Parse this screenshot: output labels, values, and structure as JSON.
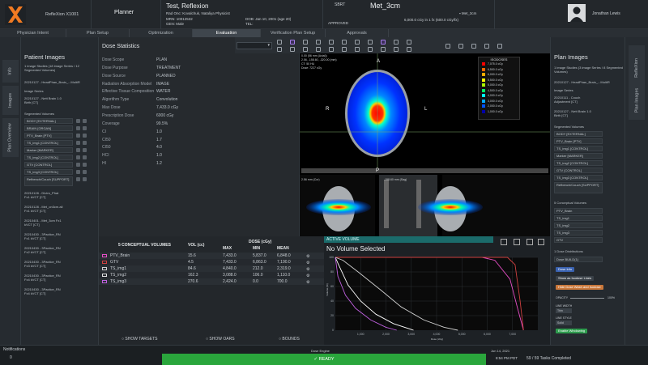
{
  "header": {
    "company": "RefleXion X1001",
    "role": "Planner",
    "patient_name": "Test, Reflexion",
    "rad_onc": "Rad Onc: Kovalchuk, Nataliya Physicist",
    "mrn": "MRN: 10012532",
    "gen": "GEN: Male",
    "dob": "DOB: Jan 10, 2001 (age 20)",
    "tel": "TEL:",
    "sbrt": "SBRT",
    "plan_name": "Met_3cm",
    "approved": "APPROVED",
    "plan_sub": "Met_3cm",
    "dose_rx": "6,000.0 cGy in 1 fx (600.0 cGy/fx)",
    "user_name": "Jonathan Lewis"
  },
  "tabs": [
    "Physician Intent",
    "Plan Setup",
    "Optimization",
    "Evaluation",
    "Verification Plan Setup",
    "Approvals"
  ],
  "active_tab": "Evaluation",
  "left_rail": {
    "tabs": [
      "Info",
      "Images",
      "Plan Overview"
    ]
  },
  "patient_images": {
    "title": "Patient Images",
    "summary": "1 image Studies (18 image Series / 12 Segmented Volumes)",
    "study": "20210127 - HeadPhan_Brain_...MultiR",
    "image_series_label": "Image Series",
    "series_1": "20210127 - Nett Brain 1.0 Birth [CT]",
    "segmented_label": "Segmented Volumes",
    "segments": [
      "BODY [EXTERNAL]",
      "BRAIN [ORGAN]",
      "PTV_Brain [PTV]",
      "TS_img1 [CONTROL]",
      "Marker [MARKER]",
      "TS_img2 [CONTROL]",
      "GTV [CONTROL]",
      "TS_img3 [CONTROL]",
      "Refbench/Couch [SUPPORT]"
    ],
    "more_series": [
      "20210128 - DIctm_Phat Fx1 kVCT [CT]",
      "20210128 - Met_on3cm.all Fx1 kVCT [CT]",
      "20210401 - Met_3cm Fx1 kVCT [CT]",
      "20210430 - 3Pactice_RN Fx1 kVCT [CT]",
      "20210430 - 3Pactice_RN Fx2 kVCT [CT]",
      "20210430 - 3Pactice_RN Fx3 kVCT [CT]",
      "20210430 - 3Pactice_RN Fx4 kVCT [CT]",
      "20210430 - 3Pactice_RN Fx4 kVCT [CT]"
    ]
  },
  "dose_stats": {
    "title": "Dose Statistics",
    "rows": [
      {
        "label": "Dose Scope",
        "value": "PLAN"
      },
      {
        "label": "Dose Purpose",
        "value": "TREATMENT"
      },
      {
        "label": "Dose Source",
        "value": "PLANNED"
      },
      {
        "label": "Radiation Absorption Model",
        "value": "IMAGE"
      },
      {
        "label": "Effective Tissue Composition",
        "value": "WATER"
      },
      {
        "label": "Algorithm Type",
        "value": "Convolution"
      },
      {
        "label": "Max Dose",
        "value": "7,433.0 cGy"
      },
      {
        "label": "Prescription Dose",
        "value": "6000 cGy"
      },
      {
        "label": "Coverage",
        "value": "99.5%"
      },
      {
        "label": "CI",
        "value": "1.0"
      },
      {
        "label": "CI50",
        "value": "1.7"
      },
      {
        "label": "CI50",
        "value": "4.0"
      },
      {
        "label": "HCI",
        "value": "1.0"
      },
      {
        "label": "HI",
        "value": "1.2"
      }
    ]
  },
  "viewer": {
    "isodoses_label": "ISODOSES",
    "axial_info": [
      "0.00 (56 mm (Axial))",
      "2.56, -158.60, -320.00 (mm)",
      "CT: 50 HU",
      "Dose: 7227 cGy"
    ],
    "label_a": "A",
    "label_r": "R",
    "label_l": "L",
    "label_p": "P",
    "coronal_info": "2.56 mm (Cor)",
    "sagittal_info": "-158.60 mm (Sag)",
    "isodoses": [
      "7,075.0 cGy",
      "6,500.0 cGy",
      "6,000.0 cGy",
      "5,500.0 cGy",
      "5,000.0 cGy",
      "4,500.0 cGy",
      "4,000.0 cGy",
      "3,000.0 cGy",
      "2,000.0 cGy",
      "1,000.0 cGy"
    ],
    "isodose_colors": [
      "#ff0000",
      "#ff6600",
      "#ffaa00",
      "#ffff00",
      "#aaff00",
      "#00ff66",
      "#00ffff",
      "#00aaff",
      "#0055ff",
      "#0000aa"
    ]
  },
  "volumes_table": {
    "title": "5 CONCEPTUAL VOLUMES",
    "col_vol": "VOL (cc)",
    "col_dose": "DOSE (cGy)",
    "col_max": "MAX",
    "col_min": "MIN",
    "col_mean": "MEAN",
    "rows": [
      {
        "name": "PTV_Brain",
        "vol": "15.6",
        "max": "7,433.0",
        "min": "5,837.0",
        "mean": "6,848.0",
        "color": "#e84fc8"
      },
      {
        "name": "GTV",
        "vol": "4.5",
        "max": "7,433.0",
        "min": "6,863.0",
        "mean": "7,190.0",
        "color": "#d04040"
      },
      {
        "name": "TS_img1",
        "vol": "84.6",
        "max": "4,840.0",
        "min": "212.0",
        "mean": "2,319.0",
        "color": "#d0d0d0"
      },
      {
        "name": "TS_img2",
        "vol": "162.3",
        "max": "3,088.0",
        "min": "106.0",
        "mean": "1,110.0",
        "color": "#e0e0e0"
      },
      {
        "name": "TS_img3",
        "vol": "270.6",
        "max": "2,424.0",
        "min": "0.0",
        "mean": "700.0",
        "color": "#c060e0"
      }
    ],
    "show_targets": "SHOW TARGETS",
    "show_oars": "SHOW OARS",
    "bounds": "BOUNDS"
  },
  "dvh": {
    "active_volume_label": "ACTIVE VOLUME",
    "selection": "No Volume Selected",
    "xlabel": "Dose (cGy)",
    "ylabel": "Volume (%)",
    "x_ticks": [
      "1,000",
      "2,000",
      "3,000",
      "4,000",
      "5,000",
      "6,000",
      "7,000"
    ],
    "y_ticks": [
      "0",
      "20",
      "40",
      "60",
      "80",
      "100"
    ]
  },
  "plan_images": {
    "title": "Plan Images",
    "summary": "1 image Studies (3 image Series / 8 Segmented Volumes)",
    "study": "20210127 - HeadPhan_Brain_...MultiR",
    "image_series_label": "Image Series",
    "series": [
      "20210111 - Couch Adjustment [CT]",
      "20210127 - Nett Brain 1.0 Birth [CT]"
    ],
    "segmented_label": "Segmented Volumes",
    "segments": [
      "BODY [EXTERNAL]",
      "PTV_Brain [PTV]",
      "TS_img1 [CONTROL]",
      "Marker [MARKER]",
      "TS_img2 [CONTROL]",
      "GTV [CONTROL]",
      "TS_img3 [CONTROL]",
      "Refbench/Couch [SUPPORT]"
    ],
    "conceptual_label": "5 Conceptual Volumes",
    "conceptual": [
      "PTV_Brain",
      "TS_img1",
      "TS_img2",
      "TS_img3",
      "GTV"
    ],
    "dose_label": "1 Dose Distributions",
    "dose_item": "Dose BUILD(1)",
    "btn_dose_info": "Dose Info",
    "btn_isodose": "Show as Isodose Lines",
    "btn_wash": "Hide Dose Wash and Isodose",
    "opacity_label": "OPACITY",
    "opacity_value": "100%",
    "line_width_label": "LINE WIDTH",
    "line_width_value": "Thin",
    "line_style_label": "LINE STYLE",
    "line_style_value": "Solid",
    "btn_windowing": "Enable Windowing"
  },
  "right_rail": {
    "tabs": [
      "RefleXion",
      "Plan Images"
    ]
  },
  "footer": {
    "notifications": "Notifications",
    "count": "0",
    "engine": "Dose Engine",
    "ready": "READY",
    "date": "Jun 14, 2021",
    "time": "8:54 PM PDT",
    "tasks": "59 / 59 Tasks Completed"
  }
}
